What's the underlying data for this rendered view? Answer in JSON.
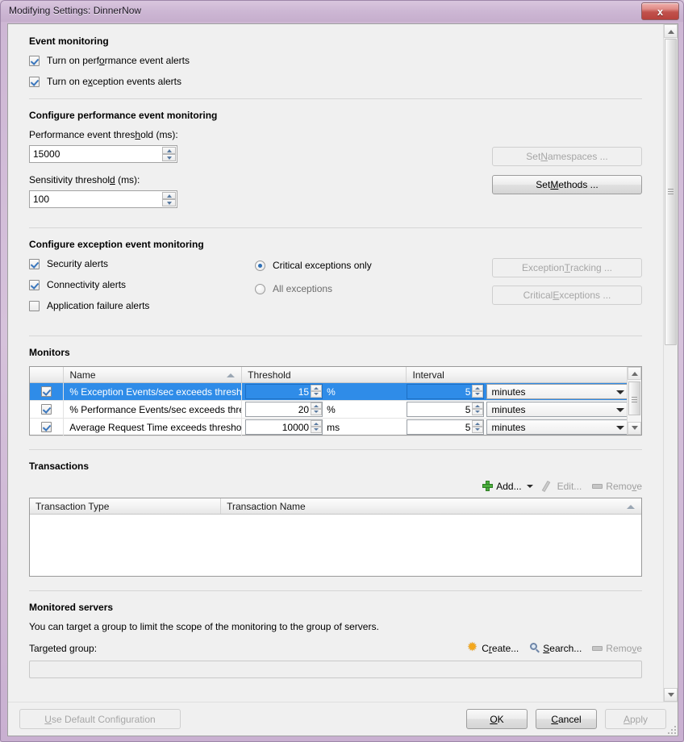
{
  "window": {
    "title": "Modifying Settings: DinnerNow",
    "close_label": "x"
  },
  "event_monitoring": {
    "heading": "Event monitoring",
    "checkboxes": [
      {
        "label_pre": "Turn on perf",
        "label_acc": "o",
        "label_post": "rmance event alerts",
        "checked": true
      },
      {
        "label_pre": "Turn on e",
        "label_acc": "x",
        "label_post": "ception events alerts",
        "checked": true
      }
    ]
  },
  "performance": {
    "heading": "Configure performance event monitoring",
    "threshold_label_pre": "Performance event thres",
    "threshold_label_acc": "h",
    "threshold_label_post": "old (ms):",
    "threshold_value": "15000",
    "sensitivity_label_pre": "Sensitivity threshol",
    "sensitivity_label_acc": "d",
    "sensitivity_label_post": " (ms):",
    "sensitivity_value": "100",
    "set_namespaces_pre": "Set ",
    "set_namespaces_acc": "N",
    "set_namespaces_post": "amespaces ...",
    "set_namespaces_enabled": false,
    "set_methods_pre": "Set ",
    "set_methods_acc": "M",
    "set_methods_post": "ethods ...",
    "set_methods_enabled": true
  },
  "exception": {
    "heading": "Configure exception event monitoring",
    "checkboxes": [
      {
        "label": "Security alerts",
        "checked": true
      },
      {
        "label": "Connectivity alerts",
        "checked": true
      },
      {
        "label": "Application failure alerts",
        "checked": false
      }
    ],
    "radios": [
      {
        "label": "Critical exceptions only",
        "selected": true
      },
      {
        "label": "All exceptions",
        "selected": false
      }
    ],
    "exception_tracking_pre": "Exception ",
    "exception_tracking_acc": "T",
    "exception_tracking_post": "racking ...",
    "exception_tracking_enabled": false,
    "critical_exceptions_pre": "Critical ",
    "critical_exceptions_acc": "E",
    "critical_exceptions_post": "xceptions ...",
    "critical_exceptions_enabled": false
  },
  "monitors": {
    "heading": "Monitors",
    "columns": [
      "",
      "Name",
      "Threshold",
      "Interval"
    ],
    "sort_column": "Name",
    "sort_direction": "ascending",
    "rows": [
      {
        "checked": true,
        "name": "% Exception Events/sec exceeds threshold",
        "threshold": "15",
        "unit": "%",
        "interval": "5",
        "interval_unit": "minutes",
        "selected": true
      },
      {
        "checked": true,
        "name": "% Performance Events/sec exceeds threshold",
        "threshold": "20",
        "unit": "%",
        "interval": "5",
        "interval_unit": "minutes",
        "selected": false
      },
      {
        "checked": true,
        "name": "Average Request Time exceeds threshold",
        "threshold": "10000",
        "unit": "ms",
        "interval": "5",
        "interval_unit": "minutes",
        "selected": false
      }
    ]
  },
  "transactions": {
    "heading": "Transactions",
    "toolbar": {
      "add_label": "Add...",
      "add_enabled": true,
      "edit_label": "Edit...",
      "edit_enabled": false,
      "remove_pre": "Remo",
      "remove_acc": "v",
      "remove_post": "e",
      "remove_enabled": false
    },
    "columns": [
      "Transaction Type",
      "Transaction Name"
    ],
    "rows": []
  },
  "monitored_servers": {
    "heading": "Monitored servers",
    "description": "You can target a group to limit the scope of the monitoring to the group of servers.",
    "targeted_group_label": "Targeted group:",
    "targeted_group_value": "",
    "toolbar": {
      "create_pre": "C",
      "create_acc": "r",
      "create_post": "eate...",
      "create_enabled": true,
      "search_pre": "",
      "search_acc": "S",
      "search_post": "earch...",
      "search_enabled": true,
      "remove_pre": "Remo",
      "remove_acc": "v",
      "remove_post": "e",
      "remove_enabled": false
    }
  },
  "footer": {
    "use_default_pre": "",
    "use_default_acc": "U",
    "use_default_post": "se Default Configuration",
    "use_default_enabled": false,
    "ok_pre": "",
    "ok_acc": "O",
    "ok_post": "K",
    "cancel_pre": "",
    "cancel_acc": "C",
    "cancel_post": "ancel",
    "apply_pre": "",
    "apply_acc": "A",
    "apply_post": "pply",
    "apply_enabled": false
  }
}
